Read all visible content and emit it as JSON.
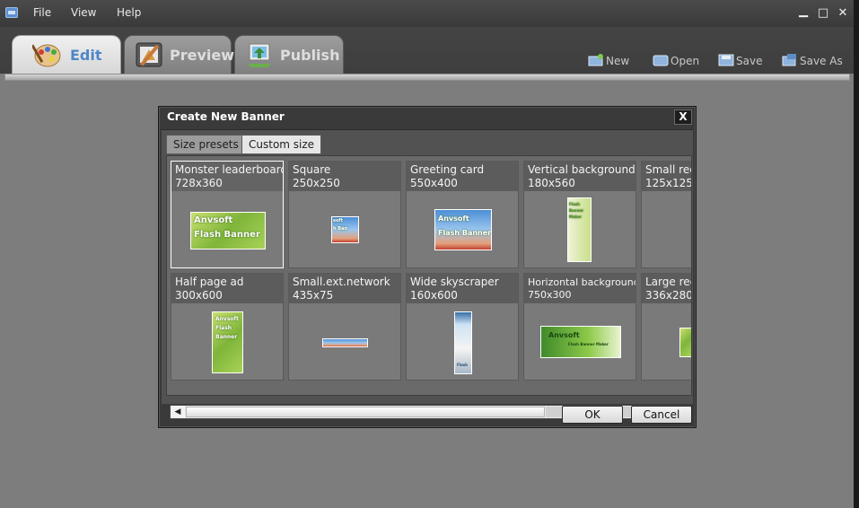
{
  "menu": {
    "items": [
      "File",
      "View",
      "Help"
    ]
  },
  "window_controls": {
    "minimize": "▁",
    "maximize": "□",
    "close": "✕"
  },
  "tabs": [
    {
      "label": "Edit",
      "icon": "palette-icon",
      "active": true
    },
    {
      "label": "Preview",
      "icon": "preview-icon",
      "active": false
    },
    {
      "label": "Publish",
      "icon": "publish-icon",
      "active": false
    }
  ],
  "tools": [
    {
      "label": "New",
      "icon": "new-icon"
    },
    {
      "label": "Open",
      "icon": "open-icon"
    },
    {
      "label": "Save",
      "icon": "save-icon"
    },
    {
      "label": "Save As",
      "icon": "save-as-icon"
    }
  ],
  "dialog": {
    "title": "Create New Banner",
    "close_label": "X",
    "subtabs": [
      {
        "label": "Size presets",
        "active": true
      },
      {
        "label": "Custom size",
        "active": false
      }
    ],
    "presets": [
      {
        "name": "Monster leaderboard",
        "size": "728x360",
        "thumb_text": [
          "Anvsoft",
          "Flash Banner"
        ],
        "selected": true
      },
      {
        "name": "Square",
        "size": "250x250",
        "thumb_text": [
          "soft",
          "h Ban"
        ]
      },
      {
        "name": "Greeting card",
        "size": "550x400",
        "thumb_text": [
          "Anvsoft",
          "Flash Banner"
        ]
      },
      {
        "name": "Vertical background",
        "size": "180x560",
        "thumb_text": [
          "Flash",
          "Banner",
          "Maker"
        ]
      },
      {
        "name": "Small rec",
        "size": "125x125",
        "thumb_text": []
      },
      {
        "name": "Half page ad",
        "size": "300x600",
        "thumb_text": [
          "Anvsoft",
          "Flash",
          "Banner"
        ]
      },
      {
        "name": "Small.ext.network",
        "size": "435x75",
        "thumb_text": []
      },
      {
        "name": "Wide skyscraper",
        "size": "160x600",
        "thumb_text": [
          "Flash"
        ]
      },
      {
        "name": "Horizontal background",
        "size": "750x300",
        "thumb_text": [
          "Anvsoft",
          "Flash Banner Maker"
        ]
      },
      {
        "name": "Large rec",
        "size": "336x280",
        "thumb_text": []
      }
    ],
    "scroll_left": "◀",
    "scroll_right": "▶",
    "ok_label": "OK",
    "cancel_label": "Cancel"
  }
}
